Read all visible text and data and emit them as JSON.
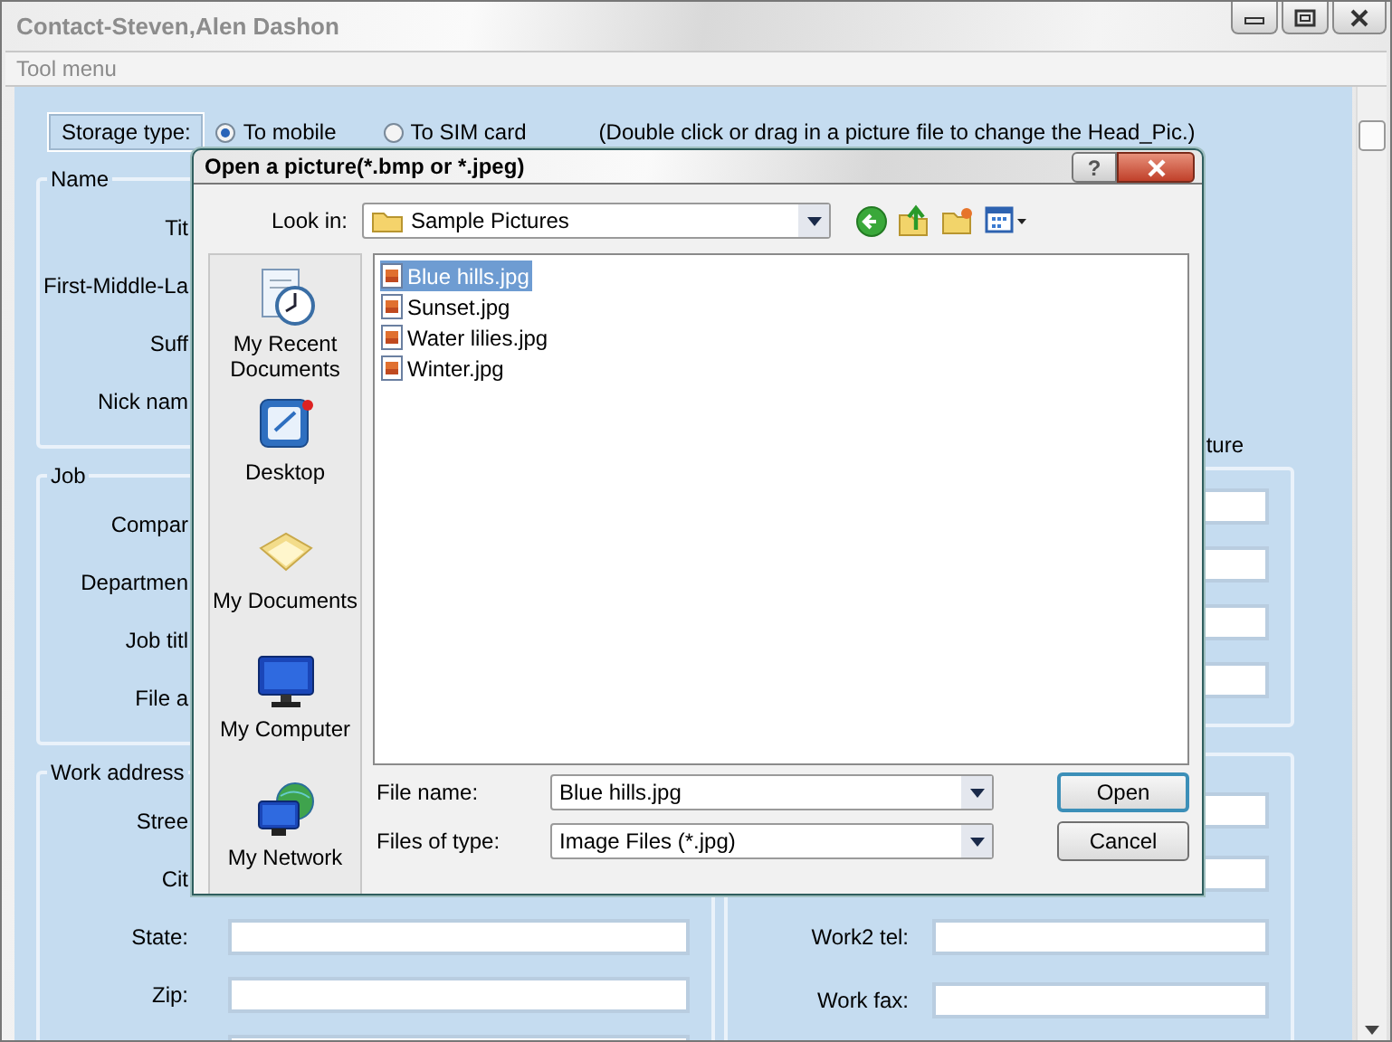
{
  "window": {
    "title": "Contact-Steven,Alen Dashon"
  },
  "menu": [
    "Tool menu"
  ],
  "storage": {
    "label": "Storage type:",
    "options": [
      {
        "label": "To mobile",
        "selected": true
      },
      {
        "label": "To SIM card",
        "selected": false
      }
    ],
    "hint": "(Double click or drag in a picture file to change the Head_Pic.)"
  },
  "left_groups": [
    {
      "title": "Name",
      "rows": [
        {
          "kind": "labeled",
          "label": "Tit"
        },
        {
          "kind": "labeled",
          "label": "First-Middle-La"
        },
        {
          "kind": "labeled",
          "label": "Suff"
        },
        {
          "kind": "labeled",
          "label": "Nick nam"
        }
      ]
    },
    {
      "title": "Job",
      "rows": [
        {
          "kind": "labeled",
          "label": "Compar"
        },
        {
          "kind": "labeled",
          "label": "Departmen"
        },
        {
          "kind": "labeled",
          "label": "Job titl"
        },
        {
          "kind": "labeled",
          "label": "File a"
        }
      ]
    },
    {
      "title": "Work address",
      "rows": [
        {
          "kind": "labeled",
          "label": "Stree"
        },
        {
          "kind": "labeled",
          "label": "Cit"
        },
        {
          "kind": "labeled_field",
          "label": "State:"
        },
        {
          "kind": "labeled_field",
          "label": "Zip:"
        },
        {
          "kind": "field"
        }
      ]
    }
  ],
  "right_caption": "ture",
  "right_groups": [
    {
      "rows": [
        {
          "kind": "field"
        },
        {
          "kind": "field"
        },
        {
          "kind": "field"
        },
        {
          "kind": "field"
        }
      ]
    },
    {
      "rows": [
        {
          "kind": "field"
        },
        {
          "kind": "field"
        },
        {
          "kind": "labeled_field",
          "label": "Work2 tel:"
        },
        {
          "kind": "labeled_field",
          "label": "Work fax:"
        }
      ]
    }
  ],
  "dialog": {
    "title": "Open a picture(*.bmp or *.jpeg)",
    "help": "?",
    "look_in": {
      "label": "Look in:",
      "value": "Sample Pictures"
    },
    "places": [
      {
        "kind": "recent",
        "label": "My Recent Documents"
      },
      {
        "kind": "desktop",
        "label": "Desktop"
      },
      {
        "kind": "documents",
        "label": "My Documents"
      },
      {
        "kind": "computer",
        "label": "My Computer"
      },
      {
        "kind": "network",
        "label": "My Network"
      }
    ],
    "files": [
      {
        "name": "Blue hills.jpg",
        "selected": true
      },
      {
        "name": "Sunset.jpg",
        "selected": false
      },
      {
        "name": "Water lilies.jpg",
        "selected": false
      },
      {
        "name": "Winter.jpg",
        "selected": false
      }
    ],
    "file_name": {
      "label": "File name:",
      "value": "Blue hills.jpg"
    },
    "file_type": {
      "label": "Files of type:",
      "value": "Image Files (*.jpg)"
    },
    "buttons": [
      {
        "label": "Open",
        "default": true
      },
      {
        "label": "Cancel",
        "default": false
      }
    ]
  }
}
